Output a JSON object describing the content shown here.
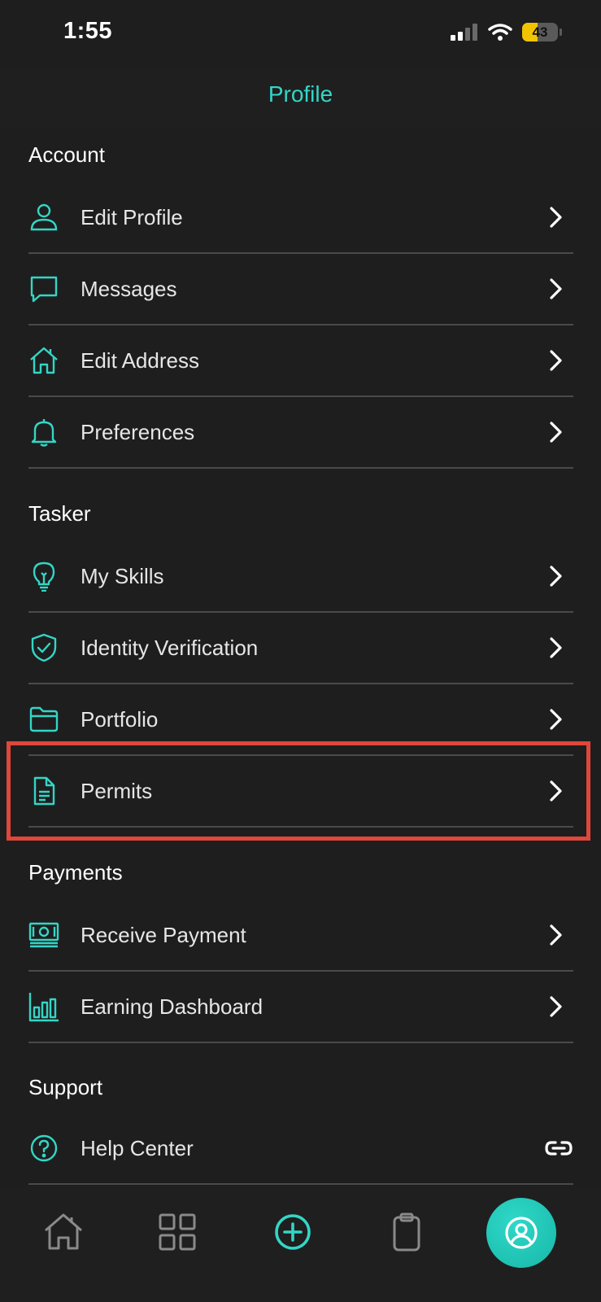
{
  "status_bar": {
    "time": "1:55",
    "battery": "43",
    "battery_level": 0.43
  },
  "header": {
    "title": "Profile"
  },
  "sections": [
    {
      "title": "Account",
      "items": [
        {
          "label": "Edit Profile",
          "icon": "person-icon"
        },
        {
          "label": "Messages",
          "icon": "chat-bubble-icon"
        },
        {
          "label": "Edit Address",
          "icon": "home-icon"
        },
        {
          "label": "Preferences",
          "icon": "bell-icon"
        }
      ]
    },
    {
      "title": "Tasker",
      "items": [
        {
          "label": "My Skills",
          "icon": "lightbulb-icon"
        },
        {
          "label": "Identity Verification",
          "icon": "shield-check-icon"
        },
        {
          "label": "Portfolio",
          "icon": "folder-icon"
        },
        {
          "label": "Permits",
          "icon": "document-icon"
        }
      ]
    },
    {
      "title": "Payments",
      "items": [
        {
          "label": "Receive Payment",
          "icon": "cash-icon"
        },
        {
          "label": "Earning Dashboard",
          "icon": "bar-chart-icon"
        }
      ]
    },
    {
      "title": "Support",
      "items": [
        {
          "label": "Help Center",
          "icon": "help-circle-icon",
          "trailing": "link-icon"
        }
      ]
    }
  ],
  "tab_bar": [
    {
      "name": "home-tab",
      "icon": "home-icon"
    },
    {
      "name": "grid-tab",
      "icon": "grid-icon"
    },
    {
      "name": "add-tab",
      "icon": "plus-circle-icon"
    },
    {
      "name": "clipboard-tab",
      "icon": "clipboard-icon"
    },
    {
      "name": "profile-tab",
      "icon": "profile-icon",
      "active": true
    }
  ],
  "colors": {
    "accent": "#33d6c6",
    "background": "#1e1e1e",
    "divider": "#4a4a4a",
    "highlight": "#e0463a",
    "battery": "#f2c400"
  }
}
